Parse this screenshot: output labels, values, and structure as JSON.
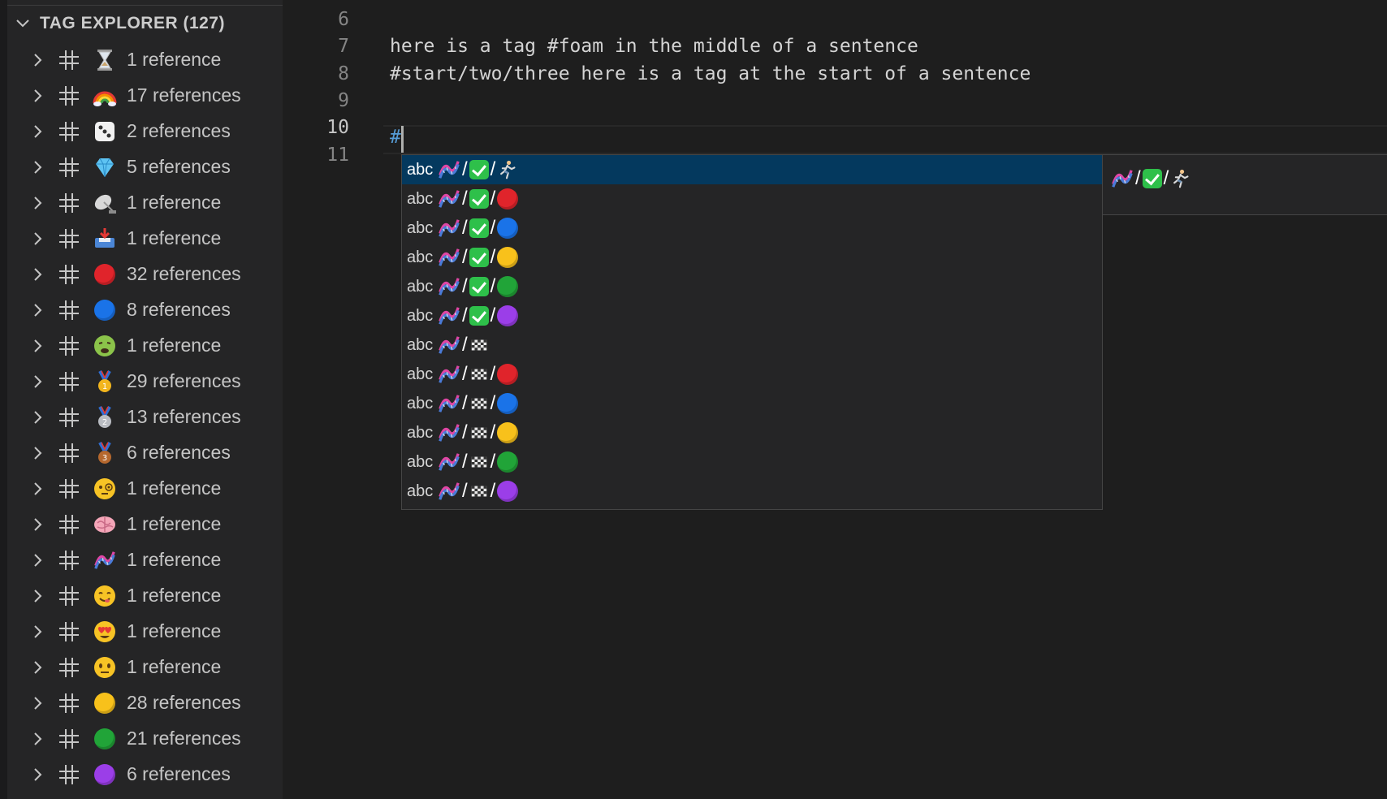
{
  "sidebar": {
    "title": "TAG EXPLORER (127)",
    "tags": [
      {
        "emoji": "hourglass",
        "label": "1 reference"
      },
      {
        "emoji": "rainbow",
        "label": "17 references"
      },
      {
        "emoji": "die",
        "label": "2 references"
      },
      {
        "emoji": "gem",
        "label": "5 references"
      },
      {
        "emoji": "satellite-antenna",
        "label": "1 reference"
      },
      {
        "emoji": "inbox-tray",
        "label": "1 reference"
      },
      {
        "emoji": "red-circle",
        "label": "32 references"
      },
      {
        "emoji": "blue-circle",
        "label": "8 references"
      },
      {
        "emoji": "nauseated-face",
        "label": "1 reference"
      },
      {
        "emoji": "gold-medal",
        "label": "29 references"
      },
      {
        "emoji": "silver-medal",
        "label": "13 references"
      },
      {
        "emoji": "bronze-medal",
        "label": "6 references"
      },
      {
        "emoji": "face-with-monocle",
        "label": "1 reference"
      },
      {
        "emoji": "brain",
        "label": "1 reference"
      },
      {
        "emoji": "dna",
        "label": "1 reference"
      },
      {
        "emoji": "face-savoring-food",
        "label": "1 reference"
      },
      {
        "emoji": "heart-eyes-face",
        "label": "1 reference"
      },
      {
        "emoji": "neutral-face",
        "label": "1 reference"
      },
      {
        "emoji": "yellow-circle",
        "label": "28 references"
      },
      {
        "emoji": "green-circle",
        "label": "21 references"
      },
      {
        "emoji": "purple-circle",
        "label": "6 references"
      }
    ]
  },
  "editor": {
    "lines": [
      {
        "number": "6",
        "text": ""
      },
      {
        "number": "7",
        "text": "here is a tag #foam in the middle of a sentence"
      },
      {
        "number": "8",
        "text": "#start/two/three here is a tag at the start of a sentence"
      },
      {
        "number": "9",
        "text": ""
      },
      {
        "number": "10",
        "text": ""
      },
      {
        "number": "11",
        "text": ""
      }
    ],
    "typed": "#"
  },
  "suggest": {
    "kind_label": "abc",
    "items": [
      {
        "parts": [
          "dna",
          "check",
          "runner"
        ]
      },
      {
        "parts": [
          "dna",
          "check",
          "red"
        ]
      },
      {
        "parts": [
          "dna",
          "check",
          "blue"
        ]
      },
      {
        "parts": [
          "dna",
          "check",
          "yellow"
        ]
      },
      {
        "parts": [
          "dna",
          "check",
          "green"
        ]
      },
      {
        "parts": [
          "dna",
          "check",
          "purple"
        ]
      },
      {
        "parts": [
          "dna",
          "flag"
        ]
      },
      {
        "parts": [
          "dna",
          "flag",
          "red"
        ]
      },
      {
        "parts": [
          "dna",
          "flag",
          "blue"
        ]
      },
      {
        "parts": [
          "dna",
          "flag",
          "yellow"
        ]
      },
      {
        "parts": [
          "dna",
          "flag",
          "green"
        ]
      },
      {
        "parts": [
          "dna",
          "flag",
          "purple"
        ]
      }
    ],
    "details_parts": [
      "dna",
      "check",
      "runner"
    ]
  },
  "colors": {
    "red": "#e0242b",
    "blue": "#1a73e8",
    "yellow": "#f8c11b",
    "green": "#21a438",
    "purple": "#9b3ee8",
    "focus": "#04395e",
    "accent": "#569cd6"
  }
}
